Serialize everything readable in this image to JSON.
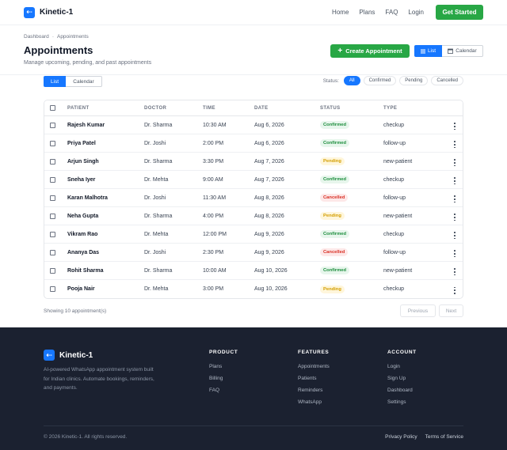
{
  "brand": {
    "name": "Kinetic-1",
    "logo_glyph": "⇠"
  },
  "nav": {
    "links": [
      "Home",
      "Plans",
      "FAQ",
      "Login"
    ],
    "cta": "Get Started"
  },
  "breadcrumb": [
    "Dashboard",
    "·",
    "Appointments"
  ],
  "page": {
    "title": "Appointments",
    "subtitle": "Manage upcoming, pending, and past appointments",
    "create_label": "Create Appointment",
    "view_list": "List",
    "view_calendar": "Calendar"
  },
  "subtabs": {
    "list": "List",
    "calendar": "Calendar"
  },
  "status_filter": {
    "label": "Status:",
    "options": [
      "All",
      "Confirmed",
      "Pending",
      "Cancelled"
    ],
    "selected": "All"
  },
  "table": {
    "columns": [
      "PATIENT",
      "DOCTOR",
      "TIME",
      "DATE",
      "STATUS",
      "TYPE"
    ],
    "rows": [
      {
        "patient": "Rajesh Kumar",
        "doctor": "Dr. Sharma",
        "time": "10:30 AM",
        "date": "Aug 6, 2026",
        "status": "Confirmed",
        "type": "checkup"
      },
      {
        "patient": "Priya Patel",
        "doctor": "Dr. Joshi",
        "time": "2:00 PM",
        "date": "Aug 6, 2026",
        "status": "Confirmed",
        "type": "follow-up"
      },
      {
        "patient": "Arjun Singh",
        "doctor": "Dr. Sharma",
        "time": "3:30 PM",
        "date": "Aug 7, 2026",
        "status": "Pending",
        "type": "new-patient"
      },
      {
        "patient": "Sneha Iyer",
        "doctor": "Dr. Mehta",
        "time": "9:00 AM",
        "date": "Aug 7, 2026",
        "status": "Confirmed",
        "type": "checkup"
      },
      {
        "patient": "Karan Malhotra",
        "doctor": "Dr. Joshi",
        "time": "11:30 AM",
        "date": "Aug 8, 2026",
        "status": "Cancelled",
        "type": "follow-up"
      },
      {
        "patient": "Neha Gupta",
        "doctor": "Dr. Sharma",
        "time": "4:00 PM",
        "date": "Aug 8, 2026",
        "status": "Pending",
        "type": "new-patient"
      },
      {
        "patient": "Vikram Rao",
        "doctor": "Dr. Mehta",
        "time": "12:00 PM",
        "date": "Aug 9, 2026",
        "status": "Confirmed",
        "type": "checkup"
      },
      {
        "patient": "Ananya Das",
        "doctor": "Dr. Joshi",
        "time": "2:30 PM",
        "date": "Aug 9, 2026",
        "status": "Cancelled",
        "type": "follow-up"
      },
      {
        "patient": "Rohit Sharma",
        "doctor": "Dr. Sharma",
        "time": "10:00 AM",
        "date": "Aug 10, 2026",
        "status": "Confirmed",
        "type": "new-patient"
      },
      {
        "patient": "Pooja Nair",
        "doctor": "Dr. Mehta",
        "time": "3:00 PM",
        "date": "Aug 10, 2026",
        "status": "Pending",
        "type": "checkup"
      }
    ]
  },
  "pagination": {
    "summary": "Showing 10 appointment(s)",
    "prev": "Previous",
    "next": "Next"
  },
  "footer": {
    "description": "AI-powered WhatsApp appointment system built for Indian clinics. Automate bookings, reminders, and payments.",
    "columns": [
      {
        "title": "PRODUCT",
        "links": [
          "Plans",
          "Billing",
          "FAQ"
        ]
      },
      {
        "title": "FEATURES",
        "links": [
          "Appointments",
          "Patients",
          "Reminders",
          "WhatsApp"
        ]
      },
      {
        "title": "ACCOUNT",
        "links": [
          "Login",
          "Sign Up",
          "Dashboard",
          "Settings"
        ]
      }
    ],
    "copyright": "© 2026 Kinetic-1. All rights reserved.",
    "legal": [
      "Privacy Policy",
      "Terms of Service"
    ]
  },
  "colors": {
    "primary": "#1677ff",
    "success": "#28a745",
    "footer_bg": "#1b2130"
  }
}
